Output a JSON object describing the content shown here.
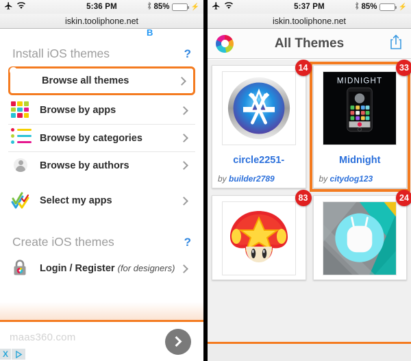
{
  "left": {
    "statusbar": {
      "airplane_icon": "airplane-icon",
      "wifi_icon": "wifi-icon",
      "time": "5:36 PM",
      "bluetooth_icon": "bluetooth-icon",
      "battery_percent": "85%",
      "battery_level": 85,
      "charging_icon": "lightning-bolt-icon"
    },
    "url": "iskin.tooliphone.net",
    "partial_text": "B",
    "install_section": {
      "title": "Install iOS themes",
      "help_label": "?",
      "items": [
        {
          "label": "Browse all themes",
          "icon": "swirl-logo-icon",
          "highlighted": true
        },
        {
          "label": "Browse by apps",
          "icon": "color-grid-icon",
          "highlighted": false
        },
        {
          "label": "Browse by categories",
          "icon": "bullet-list-icon",
          "highlighted": false
        },
        {
          "label": "Browse by authors",
          "icon": "author-avatar-icon",
          "highlighted": false
        },
        {
          "label": "Select my apps",
          "icon": "checkmarks-icon",
          "highlighted": false
        }
      ]
    },
    "create_section": {
      "title": "Create iOS themes",
      "help_label": "?",
      "items": [
        {
          "label": "Login / Register",
          "sublabel": "(for designers)",
          "icon": "lock-icon"
        }
      ]
    },
    "ad": {
      "text": "maas360.com",
      "close_label": "X",
      "adchoices_icon": "adchoices-triangle-icon",
      "next_icon": "chevron-right-icon"
    }
  },
  "right": {
    "statusbar": {
      "airplane_icon": "airplane-icon",
      "wifi_icon": "wifi-icon",
      "time": "5:37 PM",
      "bluetooth_icon": "bluetooth-icon",
      "battery_percent": "85%",
      "battery_level": 85,
      "charging_icon": "lightning-bolt-icon"
    },
    "url": "iskin.tooliphone.net",
    "appbar": {
      "logo_icon": "swirl-logo-icon",
      "title": "All Themes",
      "share_icon": "share-icon"
    },
    "themes": [
      {
        "name": "circle2251-",
        "by_prefix": "by ",
        "author": "builder2789",
        "badge": "14",
        "thumb": "appstore-icon",
        "selected": false
      },
      {
        "name": "Midnight",
        "by_prefix": "by ",
        "author": "citydog123",
        "badge": "33",
        "thumb": "midnight-iphone-icon",
        "selected": true
      },
      {
        "name": "",
        "by_prefix": "",
        "author": "",
        "badge": "83",
        "thumb": "mario-mushroom-icon",
        "selected": false
      },
      {
        "name": "",
        "by_prefix": "",
        "author": "",
        "badge": "24",
        "thumb": "android-marshmallow-icon",
        "selected": false
      }
    ]
  },
  "colors": {
    "highlight_orange": "#f47b20",
    "link_blue": "#2a6fdb",
    "badge_red": "#e02020",
    "battery_yellow": "#ffcc00",
    "muted_gray": "#9d9d9d"
  }
}
